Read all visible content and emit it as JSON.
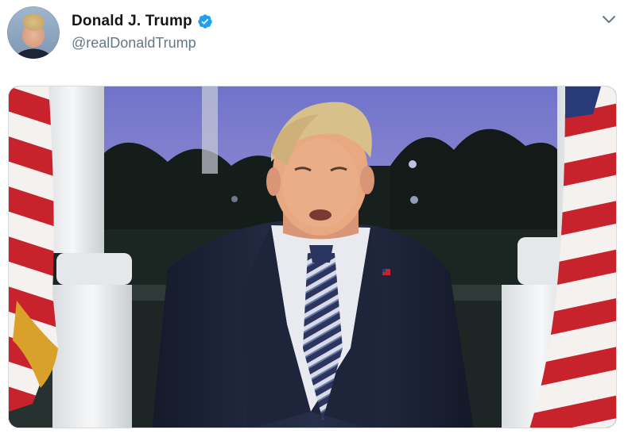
{
  "tweet": {
    "author": {
      "name": "Donald J. Trump",
      "handle": "@realDonaldTrump",
      "verified": true
    },
    "menu_icon": "chevron-down-icon",
    "media": {
      "type": "video-frame"
    }
  },
  "colors": {
    "name": "#14171a",
    "handle": "#657786",
    "verified": "#1da1f2"
  }
}
